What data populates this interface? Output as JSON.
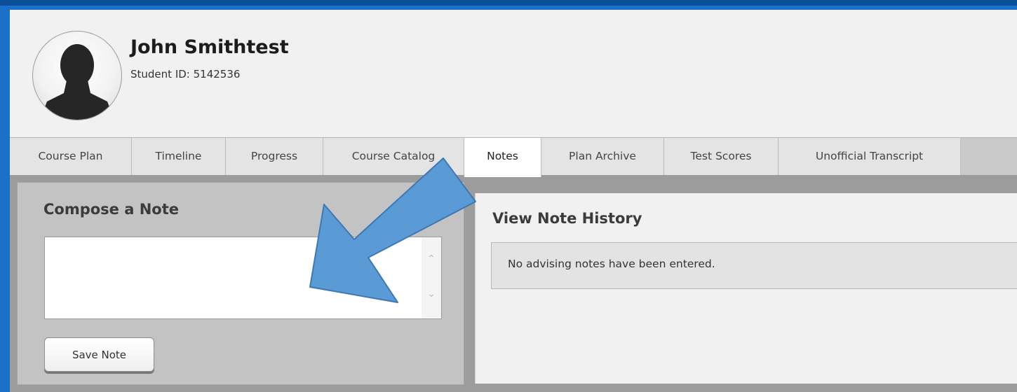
{
  "student": {
    "name": "John Smithtest",
    "id_text": "Student ID: 5142536"
  },
  "tabs": [
    {
      "label": "Course Plan",
      "active": false
    },
    {
      "label": "Timeline",
      "active": false
    },
    {
      "label": "Progress",
      "active": false
    },
    {
      "label": "Course Catalog",
      "active": false
    },
    {
      "label": "Notes",
      "active": true
    },
    {
      "label": "Plan Archive",
      "active": false
    },
    {
      "label": "Test Scores",
      "active": false
    },
    {
      "label": "Unofficial Transcript",
      "active": false
    }
  ],
  "compose": {
    "title": "Compose a Note",
    "input_value": "",
    "save_label": "Save Note"
  },
  "history": {
    "title": "View Note History",
    "empty_message": "No advising notes have been entered."
  },
  "annotation": {
    "icon": "arrow-icon",
    "color": "#5b9bd5"
  },
  "colors": {
    "frame": "#1a6fc9",
    "panel_gray": "#c3c3c3",
    "active_tab": "#ffffff"
  }
}
